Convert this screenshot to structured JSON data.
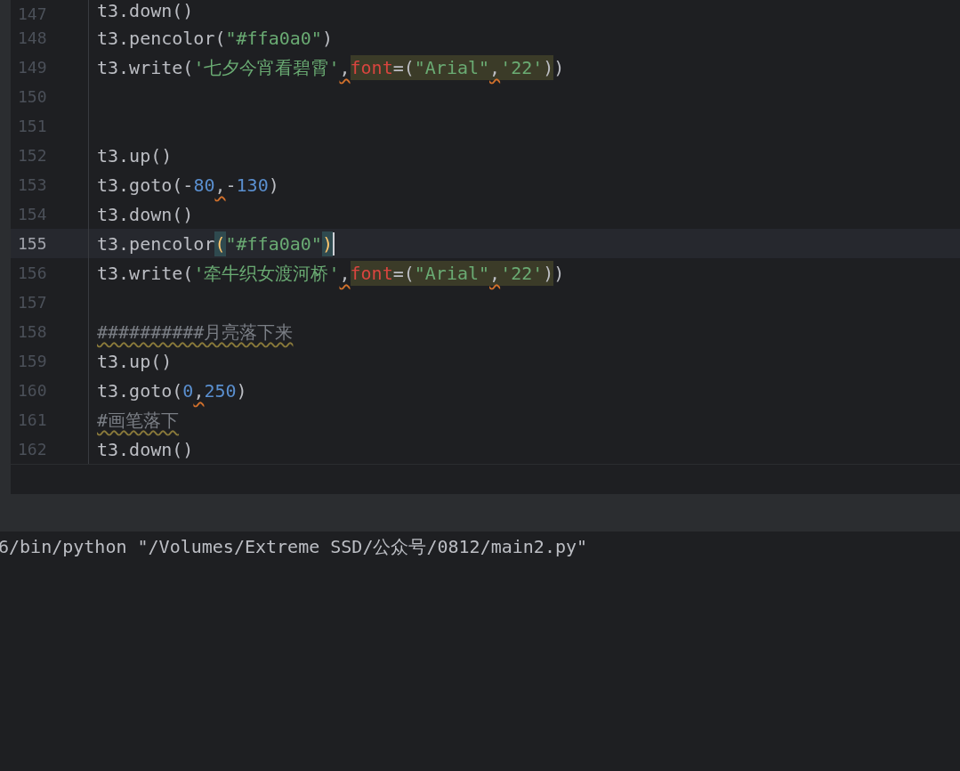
{
  "editor": {
    "lines": [
      {
        "number": "147",
        "current": false,
        "segments": [
          {
            "highlighted": false,
            "tokens": [
              {
                "text": "t3.down()",
                "kind": "code"
              }
            ]
          }
        ]
      },
      {
        "number": "148",
        "current": false,
        "segments": [
          {
            "highlighted": false,
            "tokens": [
              {
                "text": "t3.pencolor(",
                "kind": "code"
              },
              {
                "text": "\"#ffa0a0\"",
                "kind": "string"
              },
              {
                "text": ")",
                "kind": "code"
              }
            ]
          }
        ]
      },
      {
        "number": "149",
        "current": false,
        "segments": [
          {
            "highlighted": false,
            "tokens": [
              {
                "text": "t3.write(",
                "kind": "code"
              },
              {
                "text": "'七夕今宵看碧霄'",
                "kind": "string"
              },
              {
                "text": ",",
                "kind": "warn-comma"
              }
            ]
          },
          {
            "highlighted": true,
            "tokens": [
              {
                "text": "font",
                "kind": "param"
              },
              {
                "text": "=(",
                "kind": "code"
              },
              {
                "text": "\"Arial\"",
                "kind": "string"
              },
              {
                "text": ",",
                "kind": "warn-comma"
              },
              {
                "text": "'22'",
                "kind": "string"
              },
              {
                "text": ")",
                "kind": "code"
              }
            ]
          },
          {
            "highlighted": false,
            "tokens": [
              {
                "text": ")",
                "kind": "code"
              }
            ]
          }
        ]
      },
      {
        "number": "150",
        "current": false
      },
      {
        "number": "151",
        "current": false
      },
      {
        "number": "152",
        "current": false,
        "segments": [
          {
            "highlighted": false,
            "tokens": [
              {
                "text": "t3.up()",
                "kind": "code"
              }
            ]
          }
        ]
      },
      {
        "number": "153",
        "current": false,
        "segments": [
          {
            "highlighted": false,
            "tokens": [
              {
                "text": "t3.goto(-",
                "kind": "code"
              },
              {
                "text": "80",
                "kind": "number"
              },
              {
                "text": ",",
                "kind": "warn-comma"
              },
              {
                "text": "-",
                "kind": "code"
              },
              {
                "text": "130",
                "kind": "number"
              },
              {
                "text": ")",
                "kind": "code"
              }
            ]
          }
        ]
      },
      {
        "number": "154",
        "current": false,
        "segments": [
          {
            "highlighted": false,
            "tokens": [
              {
                "text": "t3.down()",
                "kind": "code"
              }
            ]
          }
        ]
      },
      {
        "number": "155",
        "current": true,
        "segments": [
          {
            "highlighted": false,
            "tokens": [
              {
                "text": "t3.pencolor",
                "kind": "code"
              },
              {
                "text": "(",
                "kind": "matched-bracket"
              },
              {
                "text": "\"#ffa0a0\"",
                "kind": "string"
              },
              {
                "text": ")",
                "kind": "matched-bracket"
              }
            ]
          }
        ]
      },
      {
        "number": "156",
        "current": false,
        "segments": [
          {
            "highlighted": false,
            "tokens": [
              {
                "text": "t3.write(",
                "kind": "code"
              },
              {
                "text": "'牵牛织女渡河桥'",
                "kind": "string"
              },
              {
                "text": ",",
                "kind": "warn-comma"
              }
            ]
          },
          {
            "highlighted": true,
            "tokens": [
              {
                "text": "font",
                "kind": "param"
              },
              {
                "text": "=(",
                "kind": "code"
              },
              {
                "text": "\"Arial\"",
                "kind": "string"
              },
              {
                "text": ",",
                "kind": "warn-comma"
              },
              {
                "text": "'22'",
                "kind": "string"
              },
              {
                "text": ")",
                "kind": "code"
              }
            ]
          },
          {
            "highlighted": false,
            "tokens": [
              {
                "text": ")",
                "kind": "code"
              }
            ]
          }
        ]
      },
      {
        "number": "157",
        "current": false
      },
      {
        "number": "158",
        "current": false,
        "segments": [
          {
            "highlighted": false,
            "tokens": [
              {
                "text": "##########月亮落下来",
                "kind": "comment"
              }
            ]
          }
        ]
      },
      {
        "number": "159",
        "current": false,
        "segments": [
          {
            "highlighted": false,
            "tokens": [
              {
                "text": "t3.up()",
                "kind": "code"
              }
            ]
          }
        ]
      },
      {
        "number": "160",
        "current": false,
        "segments": [
          {
            "highlighted": false,
            "tokens": [
              {
                "text": "t3.goto(",
                "kind": "code"
              },
              {
                "text": "0",
                "kind": "number"
              },
              {
                "text": ",",
                "kind": "warn-comma"
              },
              {
                "text": "250",
                "kind": "number"
              },
              {
                "text": ")",
                "kind": "code"
              }
            ]
          }
        ]
      },
      {
        "number": "161",
        "current": false,
        "segments": [
          {
            "highlighted": false,
            "tokens": [
              {
                "text": "#画笔落下",
                "kind": "comment"
              }
            ]
          }
        ]
      },
      {
        "number": "162",
        "current": false,
        "segments": [
          {
            "highlighted": false,
            "tokens": [
              {
                "text": "t3.down()",
                "kind": "code"
              }
            ]
          }
        ]
      }
    ]
  },
  "terminal": {
    "lines": [
      "6/bin/python \"/Volumes/Extreme SSD/公众号/0812/main2.py\""
    ]
  }
}
